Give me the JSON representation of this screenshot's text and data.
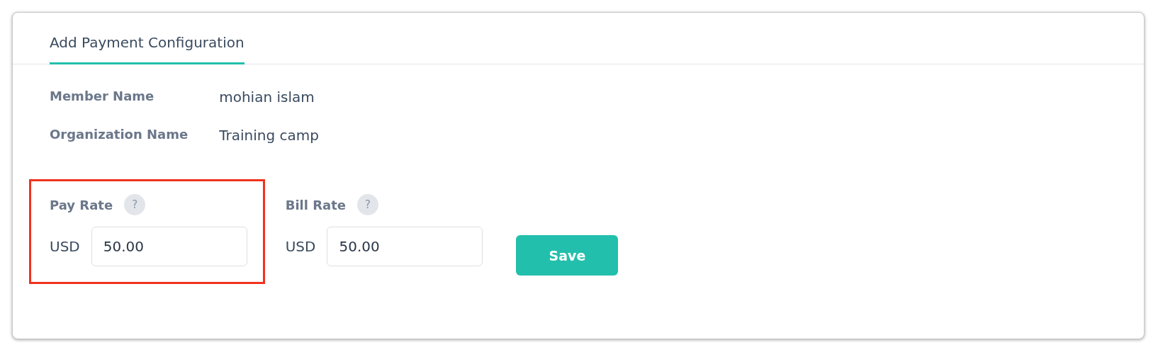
{
  "tabs": [
    {
      "label": "Add Payment Configuration",
      "selected": true
    }
  ],
  "details": [
    {
      "label": "Member Name",
      "value": "mohian islam"
    },
    {
      "label": "Organization Name",
      "value": "Training camp"
    }
  ],
  "rates": [
    {
      "label": "Pay Rate",
      "help": "?",
      "currency": "USD",
      "value": "50.00",
      "highlighted": true
    },
    {
      "label": "Bill Rate",
      "help": "?",
      "currency": "USD",
      "value": "50.00",
      "highlighted": false
    }
  ],
  "save_button": "Save"
}
